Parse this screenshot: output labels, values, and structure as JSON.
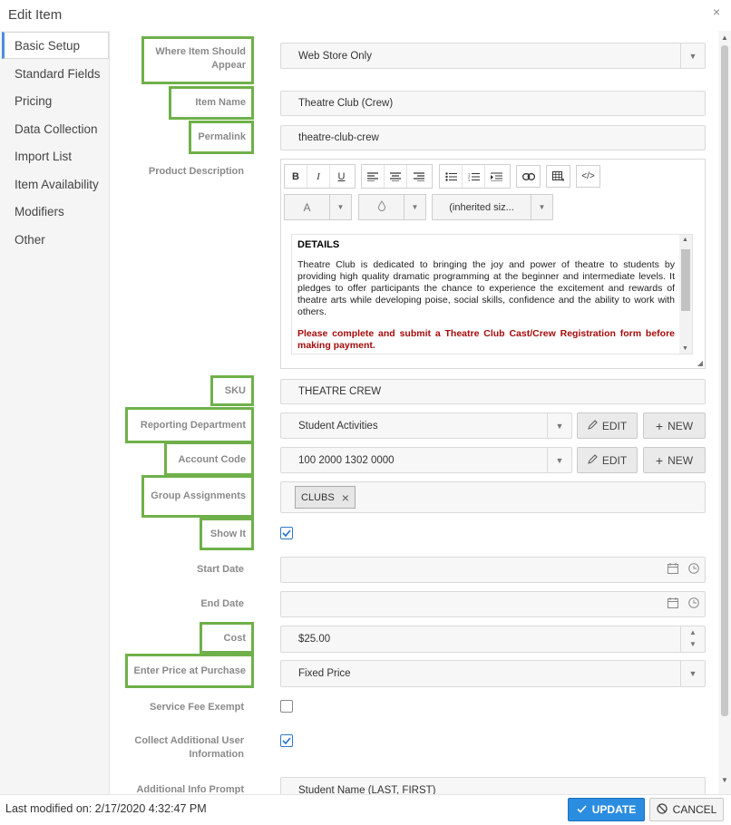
{
  "window": {
    "title": "Edit Item",
    "close_icon": "×"
  },
  "sidebar": {
    "items": [
      {
        "label": "Basic Setup"
      },
      {
        "label": "Standard Fields"
      },
      {
        "label": "Pricing"
      },
      {
        "label": "Data Collection"
      },
      {
        "label": "Import List"
      },
      {
        "label": "Item Availability"
      },
      {
        "label": "Modifiers"
      },
      {
        "label": "Other"
      }
    ],
    "active_index": 0
  },
  "form": {
    "where_label": "Where Item Should Appear",
    "where_value": "Web Store Only",
    "item_name_label": "Item Name",
    "item_name_value": "Theatre Club (Crew)",
    "permalink_label": "Permalink",
    "permalink_value": "theatre-club-crew",
    "description_label": "Product Description",
    "sku_label": "SKU",
    "sku_value": "THEATRE CREW",
    "reporting_label": "Reporting Department",
    "reporting_value": "Student Activities",
    "account_label": "Account Code",
    "account_value": "100 2000 1302 0000",
    "group_label": "Group Assignments",
    "group_chip": "CLUBS",
    "group_chip_remove": "×",
    "showit_label": "Show It",
    "showit_checked": true,
    "start_label": "Start Date",
    "start_value": "",
    "end_label": "End Date",
    "end_value": "",
    "cost_label": "Cost",
    "cost_value": "$25.00",
    "price_label": "Enter Price at Purchase",
    "price_value": "Fixed Price",
    "fee_label": "Service Fee Exempt",
    "fee_checked": false,
    "collect_label": "Collect Additional User Information",
    "collect_checked": true,
    "prompt_label": "Additional Info Prompt",
    "prompt_value": "Student Name (LAST, FIRST)",
    "edit_label": "EDIT",
    "new_label": "NEW"
  },
  "editor": {
    "toolbar": {
      "bold": "B",
      "italic": "I",
      "underline": "U",
      "font_color": "A",
      "font_size": "(inherited siz..."
    },
    "heading": "DETAILS",
    "body": "Theatre Club is dedicated to bringing the joy and power of theatre to students by providing high quality dramatic programming at the beginner and intermediate levels. It pledges to offer participants the chance to experience the excitement and rewards of theatre arts while developing poise, social skills, confidence and the ability to work with others.",
    "note": "Please complete and submit a Theatre Club Cast/Crew Registration form before making payment."
  },
  "footer": {
    "last_modified": "Last modified on: 2/17/2020 4:32:47 PM",
    "update_label": "UPDATE",
    "cancel_label": "CANCEL"
  },
  "colors": {
    "highlight_box": "#6fb04a",
    "primary_button": "#2b8de0",
    "active_tab_accent": "#4a90d9",
    "note_red": "#a50b0b"
  }
}
